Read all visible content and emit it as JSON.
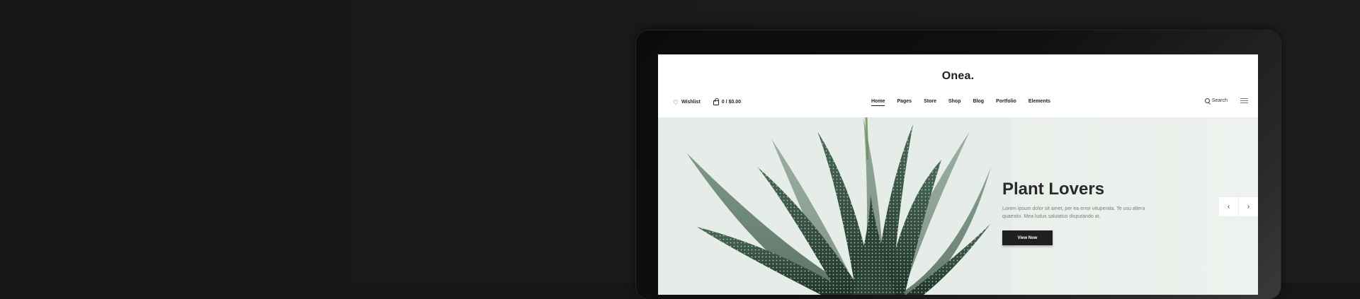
{
  "site": {
    "logo": "Onea."
  },
  "header": {
    "wishlist_label": "Wishlist",
    "cart_label": "0 / $0.00",
    "search_label": "Search",
    "nav": [
      {
        "label": "Home",
        "active": true
      },
      {
        "label": "Pages",
        "active": false
      },
      {
        "label": "Store",
        "active": false
      },
      {
        "label": "Shop",
        "active": false
      },
      {
        "label": "Blog",
        "active": false
      },
      {
        "label": "Portfolio",
        "active": false
      },
      {
        "label": "Elements",
        "active": false
      }
    ]
  },
  "hero": {
    "title": "Plant Lovers",
    "description": "Lorem ipsum dolor sit amet, per ea error vituperata. Te usu altera quaestio. Mea ludus salutatus disputando at.",
    "button_label": "View Now",
    "prev_icon": "‹",
    "next_icon": "›"
  },
  "colors": {
    "background": "#171717",
    "hero_bg": "#e8eee9",
    "button_bg": "#1f1f1f",
    "plant_green": "#3e5a4c"
  }
}
